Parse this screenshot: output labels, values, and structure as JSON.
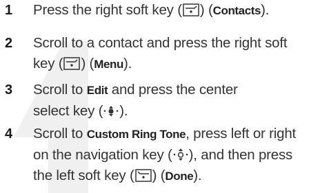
{
  "steps": [
    {
      "number": "1",
      "lines": [
        {
          "a": "Press the right soft key (",
          "b": ") (",
          "bold": "Contacts",
          "c": ")."
        }
      ]
    },
    {
      "number": "2",
      "lines": [
        {
          "a": "Scroll to a contact and press the right soft"
        },
        {
          "a": "key (",
          "b": ") (",
          "bold": "Menu",
          "c": ")."
        }
      ]
    },
    {
      "number": "3",
      "lines": [
        {
          "a": "Scroll to ",
          "bold": "Edit",
          "b": " and press the center"
        },
        {
          "a": "select key (",
          "c": ")."
        }
      ]
    },
    {
      "number": "4",
      "lines": [
        {
          "a": "Scroll to ",
          "bold": "Custom Ring Tone",
          "b": ", press left or right"
        },
        {
          "a": "on the navigation key (",
          "c": "), and then press"
        },
        {
          "a": "the left soft key (",
          "b": ") (",
          "bold": "Done",
          "c": ")."
        }
      ]
    }
  ],
  "icons": {
    "right_soft_key": "right-soft-key-icon",
    "left_soft_key": "left-soft-key-icon",
    "center_select_key": "center-select-key-icon",
    "navigation_key": "navigation-key-icon"
  },
  "colors": {
    "text": "#333333",
    "number": "#1a1a1a",
    "watermark": "#ececec"
  }
}
